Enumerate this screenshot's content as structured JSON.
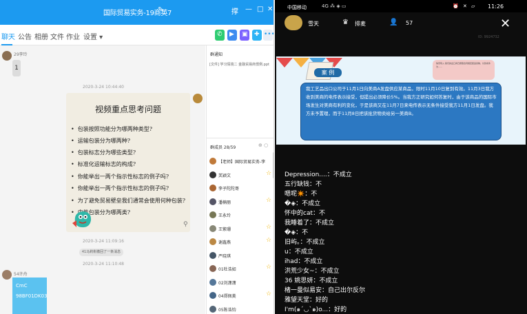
{
  "qq": {
    "title": "国际贸易实务-19商英7",
    "title_controls": [
      "撑",
      "—",
      "□",
      "✕"
    ],
    "tabs": [
      "聊天",
      "公告",
      "相册",
      "文件",
      "作业",
      "设置 ▾"
    ],
    "tool_colors": [
      "#2ecc71",
      "#3d8bf0",
      "#7b61ff",
      "#2db4f5"
    ],
    "messages": {
      "first_sender": "29李玲",
      "first_text": "1",
      "time1": "2020-3-24 10:44:40",
      "card_title": "视频重点思考问题",
      "card_items": [
        "包装按照功能分为哪两种类型?",
        "运输包装分为哪两种?",
        "包装标志分为哪些类型?",
        "标准化运输标志的构成?",
        "你能举出一两个指示性标志的例子吗?",
        "你能举出一两个指示性标志的例子吗?",
        "为了避免贸易壁垒我们通常会使用何种包装?",
        "中性包装分为哪两类?"
      ],
      "time2": "2020-3-24 11:09:16",
      "sys_msg": "41马莉彬撤回了一条消息",
      "time3": "2020-3-24 11:10:48",
      "second_sender": "54许舟",
      "cmc_lines": [
        "CmC",
        "98BF01DK03"
      ]
    },
    "notice": {
      "title": "群通知",
      "body": "[文件] 学习情境二 金融贸易商惯例.ppt"
    },
    "members": {
      "title": "群成员 28/59",
      "tools": "⊕ ○",
      "list": [
        {
          "name": "【老师】国际贸易实务-李",
          "color": "#c07a3a",
          "star": false
        },
        {
          "name": "芙颖文",
          "color": "#333",
          "star": true
        },
        {
          "name": "李子陀陀哥",
          "color": "#a63",
          "star": false
        },
        {
          "name": "潘楠丽",
          "color": "#556",
          "star": true
        },
        {
          "name": "王永玲",
          "color": "#775",
          "star": false
        },
        {
          "name": "王紫珊",
          "color": "#887",
          "star": true
        },
        {
          "name": "谢鑫燕",
          "color": "#b84",
          "star": true
        },
        {
          "name": "严晓琪",
          "color": "#456",
          "star": false
        },
        {
          "name": "01杜浩如",
          "color": "#865",
          "star": true
        },
        {
          "name": "02刘潇潇",
          "color": "#579",
          "star": false
        },
        {
          "name": "04郑佩美",
          "color": "#468",
          "star": true
        },
        {
          "name": "05陈浩钧",
          "color": "#567",
          "star": false
        }
      ]
    }
  },
  "phone": {
    "status": {
      "carrier": "中国移动",
      "network": "4G ⁂ ◈ ▭",
      "right_icons": "⏰ ✕ ▱",
      "time": "11:26"
    },
    "room": {
      "host": "雪天",
      "rank_label": "排麦",
      "viewers": "57",
      "id": "ID: 9924732"
    },
    "slide": {
      "tag": "案 例",
      "note": "情景导入\n我们的出口商已按照合同规定装运货物，付款条件为……",
      "text": "我工艺品出口公司于11月1日向美商A发盘供应某商品，限时11月10日复到有效。11月3日我方收到美商的电传表示接受，但提出必须降价5%。当我方正研究如何答复时，由于该商品的国际市场发生对美商有利的变化，于是该商又在11月7日来电传表示无条件接受我方11月1日发盘。我方未予置理，而于11月8日把该批货物卖给另一美商B。"
    },
    "comments": [
      "Depression....：不成立",
      "五行缺钱：不",
      "嗯呢✴️：不",
      "�◈：不成立",
      "怀中的cat：不",
      "我睡着了：不成立",
      "�◈：不",
      "旧屿。：不成立",
      "u：不成立",
      "ihad：不成立",
      "洪荒少女~：不成立",
      "36 姚思妍：不成立",
      "楮一曼似易安：自己出尔反尔",
      "雅望天堂：好的",
      "I'm(๑´◡`๑)o...：好的"
    ]
  }
}
